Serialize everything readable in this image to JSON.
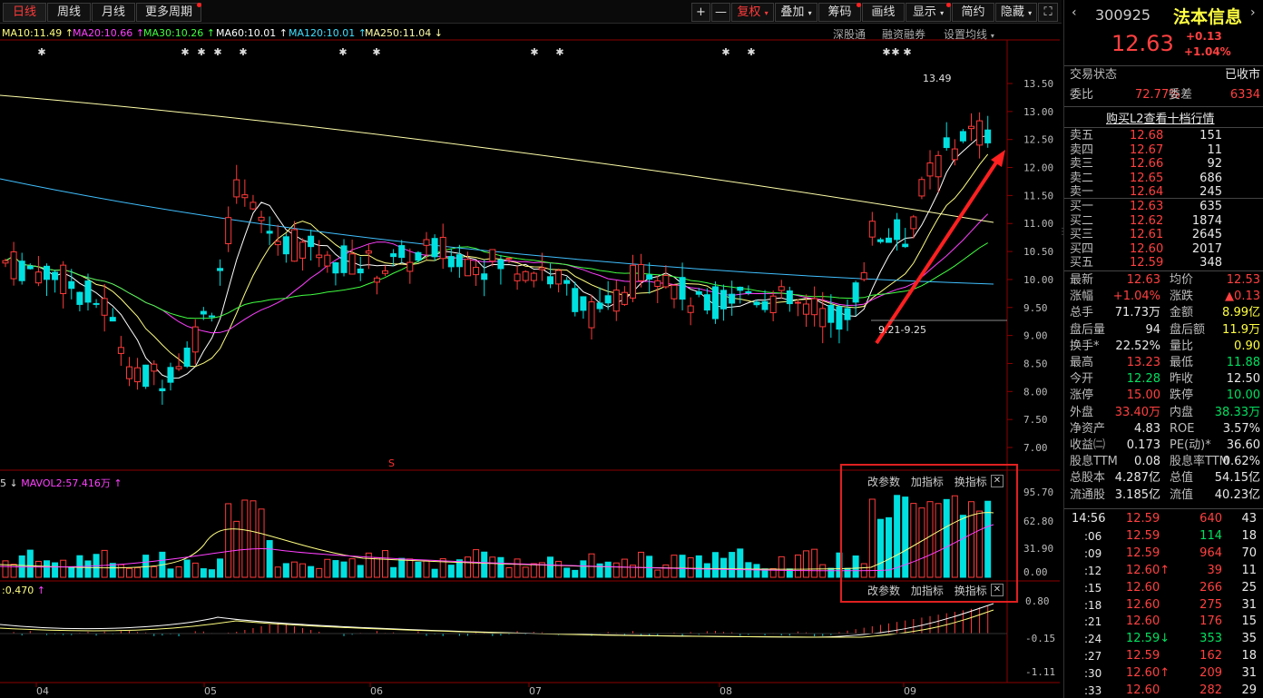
{
  "toolbar": {
    "tabs": [
      "日线",
      "周线",
      "月线",
      "更多周期"
    ],
    "buttons": [
      "+",
      "—",
      "复权",
      "叠加",
      "筹码",
      "画线",
      "显示",
      "简约",
      "隐藏"
    ],
    "fq_label": "复权"
  },
  "ma_bar": {
    "items": [
      {
        "label": "MA10:11.49",
        "color": "#ffff80",
        "arrow": "↑"
      },
      {
        "label": "MA20:10.66",
        "color": "#ff40ff",
        "arrow": "↑"
      },
      {
        "label": "MA30:10.26",
        "color": "#40ff40",
        "arrow": "↑"
      },
      {
        "label": "MA60:10.01",
        "color": "#ffffff",
        "arrow": "↑"
      },
      {
        "label": "MA120:10.01",
        "color": "#40e0ff",
        "arrow": "↑"
      },
      {
        "label": "MA250:11.04",
        "color": "#ffffaa",
        "arrow": "↓"
      }
    ],
    "links": [
      "深股通",
      "融资融券",
      "设置均线"
    ]
  },
  "chart": {
    "price_ticks": [
      "13.50",
      "13.00",
      "12.50",
      "12.00",
      "11.50",
      "11.00",
      "10.50",
      "10.00",
      "9.50",
      "9.00",
      "8.50",
      "8.00",
      "7.50",
      "7.00"
    ],
    "months": [
      "04",
      "05",
      "06",
      "07",
      "08",
      "09"
    ],
    "high_label": "13.49",
    "low_label": "9.21-9.25",
    "vol_label": "MAVOL2:57.416万",
    "vol_prefix": "5",
    "vol_ticks": [
      "95.70",
      "62.80",
      "31.90",
      "0.00"
    ],
    "macd_label": ":0.470",
    "macd_ticks": [
      "0.80",
      "-0.15",
      "-1.11"
    ],
    "indicator_links": [
      "改参数",
      "加指标",
      "换指标"
    ],
    "s_mark": "S"
  },
  "panel": {
    "code": "300925",
    "name": "法本信息",
    "price": "12.63",
    "change": "+0.13",
    "change_pct": "+1.04%",
    "trade_status_label": "交易状态",
    "trade_status": "已收市",
    "wb_label": "委比",
    "wb": "72.77%",
    "wc_label": "委差",
    "wc": "6334",
    "l2_link": "购买L2查看十档行情",
    "asks": [
      {
        "label": "卖五",
        "price": "12.68",
        "vol": "151"
      },
      {
        "label": "卖四",
        "price": "12.67",
        "vol": "11"
      },
      {
        "label": "卖三",
        "price": "12.66",
        "vol": "92"
      },
      {
        "label": "卖二",
        "price": "12.65",
        "vol": "686"
      },
      {
        "label": "卖一",
        "price": "12.64",
        "vol": "245"
      }
    ],
    "bids": [
      {
        "label": "买一",
        "price": "12.63",
        "vol": "635"
      },
      {
        "label": "买二",
        "price": "12.62",
        "vol": "1874"
      },
      {
        "label": "买三",
        "price": "12.61",
        "vol": "2645"
      },
      {
        "label": "买四",
        "price": "12.60",
        "vol": "2017"
      },
      {
        "label": "买五",
        "price": "12.59",
        "vol": "348"
      }
    ],
    "stats": [
      {
        "l1": "最新",
        "v1": "12.63",
        "c1": "red",
        "l2": "均价",
        "v2": "12.53",
        "c2": "red"
      },
      {
        "l1": "涨幅",
        "v1": "+1.04%",
        "c1": "red",
        "l2": "涨跌",
        "v2": "▲0.13",
        "c2": "red"
      },
      {
        "l1": "总手",
        "v1": "71.73万",
        "c1": "wht",
        "l2": "金额",
        "v2": "8.99亿",
        "c2": "yel"
      },
      {
        "l1": "盘后量",
        "v1": "94",
        "c1": "wht",
        "l2": "盘后额",
        "v2": "11.9万",
        "c2": "yel"
      },
      {
        "l1": "换手*",
        "v1": "22.52%",
        "c1": "wht",
        "l2": "量比",
        "v2": "0.90",
        "c2": "yel"
      },
      {
        "l1": "最高",
        "v1": "13.23",
        "c1": "red",
        "l2": "最低",
        "v2": "11.88",
        "c2": "grn"
      },
      {
        "l1": "今开",
        "v1": "12.28",
        "c1": "grn",
        "l2": "昨收",
        "v2": "12.50",
        "c2": "wht"
      },
      {
        "l1": "涨停",
        "v1": "15.00",
        "c1": "red",
        "l2": "跌停",
        "v2": "10.00",
        "c2": "grn"
      },
      {
        "l1": "外盘",
        "v1": "33.40万",
        "c1": "red",
        "l2": "内盘",
        "v2": "38.33万",
        "c2": "grn"
      },
      {
        "l1": "净资产",
        "v1": "4.83",
        "c1": "wht",
        "l2": "ROE",
        "v2": "3.57%",
        "c2": "wht"
      },
      {
        "l1": "收益㈡",
        "v1": "0.173",
        "c1": "wht",
        "l2": "PE(动)*",
        "v2": "36.60",
        "c2": "wht"
      },
      {
        "l1": "股息TTM",
        "v1": "0.08",
        "c1": "wht",
        "l2": "股息率TTM",
        "v2": "0.62%",
        "c2": "wht"
      },
      {
        "l1": "总股本",
        "v1": "4.287亿",
        "c1": "wht",
        "l2": "总值",
        "v2": "54.15亿",
        "c2": "wht"
      },
      {
        "l1": "流通股",
        "v1": "3.185亿",
        "c1": "wht",
        "l2": "流值",
        "v2": "40.23亿",
        "c2": "wht"
      }
    ],
    "ticks": [
      {
        "t": "14:56",
        "p": "12.59",
        "pc": "red",
        "v": "640",
        "vc": "red",
        "n": "43"
      },
      {
        "t": ":06",
        "p": "12.59",
        "pc": "red",
        "v": "114",
        "vc": "grn",
        "n": "18"
      },
      {
        "t": ":09",
        "p": "12.59",
        "pc": "red",
        "v": "964",
        "vc": "red",
        "n": "70"
      },
      {
        "t": ":12",
        "p": "12.60↑",
        "pc": "red",
        "v": "39",
        "vc": "red",
        "n": "11"
      },
      {
        "t": ":15",
        "p": "12.60",
        "pc": "red",
        "v": "266",
        "vc": "red",
        "n": "25"
      },
      {
        "t": ":18",
        "p": "12.60",
        "pc": "red",
        "v": "275",
        "vc": "red",
        "n": "31"
      },
      {
        "t": ":21",
        "p": "12.60",
        "pc": "red",
        "v": "176",
        "vc": "red",
        "n": "15"
      },
      {
        "t": ":24",
        "p": "12.59↓",
        "pc": "grn",
        "v": "353",
        "vc": "grn",
        "n": "35"
      },
      {
        "t": ":27",
        "p": "12.59",
        "pc": "red",
        "v": "162",
        "vc": "red",
        "n": "18"
      },
      {
        "t": ":30",
        "p": "12.60↑",
        "pc": "red",
        "v": "209",
        "vc": "red",
        "n": "31"
      },
      {
        "t": ":33",
        "p": "12.60",
        "pc": "red",
        "v": "282",
        "vc": "red",
        "n": "29"
      }
    ]
  }
}
